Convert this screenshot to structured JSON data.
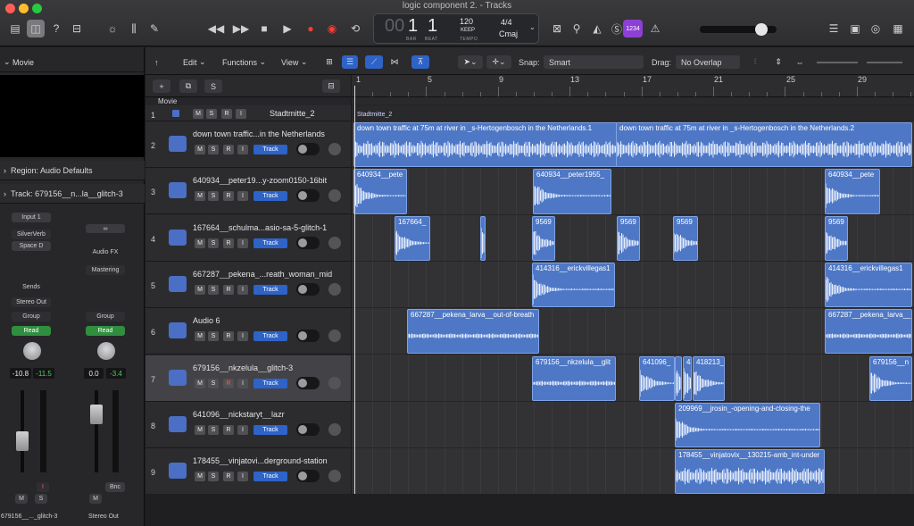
{
  "window": {
    "title": "logic component 2. - Tracks"
  },
  "lcd": {
    "bar": "1",
    "beat": "1",
    "bar_label": "BAR",
    "beat_label": "BEAT",
    "tempo": "120",
    "keep": "KEEP",
    "tempo_label": "TEMPO",
    "signature": "4/4",
    "key": "Cmaj"
  },
  "cpu_badge": "1234",
  "inspector": {
    "movie_header": "Movie",
    "region_header": "Region: Audio Defaults",
    "track_header": "Track: 679156__n...la__glitch-3",
    "strip1": {
      "input": "Input 1",
      "plugin1": "SilverVerb",
      "plugin2": "Space D",
      "sends": "Sends",
      "output": "Stereo Out",
      "group": "Group",
      "automation": "Read",
      "vol_left": "-10.8",
      "vol_right": "-11.5",
      "mute": "M",
      "solo": "S",
      "rec": "I",
      "name": "679156__..._glitch-3"
    },
    "strip2": {
      "audiofx": "Audio FX",
      "mastering": "Mastering",
      "group": "Group",
      "automation": "Read",
      "vol_left": "0.0",
      "vol_right": "-3.4",
      "bounce": "Bnc",
      "name": "Stereo Out",
      "mute": "M"
    }
  },
  "toolbar": {
    "edit": "Edit",
    "functions": "Functions",
    "view": "View",
    "snap_label": "Snap:",
    "snap_value": "Smart",
    "drag_label": "Drag:",
    "drag_value": "No Overlap"
  },
  "header_buttons": {
    "add": "+",
    "dup": "⧉",
    "s": "S"
  },
  "ruler": {
    "bars": [
      "1",
      "5",
      "9",
      "13",
      "17",
      "21",
      "25",
      "29"
    ]
  },
  "tracks": [
    {
      "num": "1",
      "name": "Stadtmitte_2",
      "mute": "M",
      "solo": "S",
      "rec": "R",
      "input": "I"
    },
    {
      "num": "2",
      "name": "down town traffic...in the Netherlands",
      "mute": "M",
      "solo": "S",
      "rec": "R",
      "input": "I",
      "btn": "Track"
    },
    {
      "num": "3",
      "name": "640934__peter19...y-zoom0150-16bit",
      "mute": "M",
      "solo": "S",
      "rec": "R",
      "input": "I",
      "btn": "Track"
    },
    {
      "num": "4",
      "name": "167664__schulma...asio-sa-5-glitch-1",
      "mute": "M",
      "solo": "S",
      "rec": "R",
      "input": "I",
      "btn": "Track"
    },
    {
      "num": "5",
      "name": "667287__pekena_...reath_woman_mid",
      "mute": "M",
      "solo": "S",
      "rec": "R",
      "input": "I",
      "btn": "Track"
    },
    {
      "num": "6",
      "name": "Audio 6",
      "mute": "M",
      "solo": "S",
      "rec": "R",
      "input": "I",
      "btn": "Track"
    },
    {
      "num": "7",
      "name": "679156__nkzelula__glitch-3",
      "mute": "M",
      "solo": "S",
      "rec": "R",
      "input": "I",
      "btn": "Track"
    },
    {
      "num": "8",
      "name": "641096__nickstaryt__lazr",
      "mute": "M",
      "solo": "S",
      "rec": "R",
      "input": "I",
      "btn": "Track"
    },
    {
      "num": "9",
      "name": "178455__vinjatovi...derground-station",
      "mute": "M",
      "solo": "S",
      "rec": "R",
      "input": "I",
      "btn": "Track"
    }
  ],
  "movie_lane": {
    "label": "Movie"
  },
  "regions": {
    "movie": "Stadtmitte_2",
    "t2a": "down town traffic at 75m at river in _s-Hertogenbosch in the Netherlands.1",
    "t2b": "down town traffic at 75m at river in _s-Hertogenbosch in the Netherlands.2",
    "t3a": "640934__pete",
    "t3b": "640934__peter1955_",
    "t3c": "640934__pete",
    "t4a": "167664_",
    "t4b": "9569",
    "t4c": "9569",
    "t4d": "9569",
    "t4e": "9569",
    "t5a": "414316__erickvillegas1",
    "t5b": "414316__erickvillegas1",
    "t6a": "667287__pekena_larva__out-of-breath",
    "t6b": "667287__pekena_larva__",
    "t7a": "679156__nkzelula__glit",
    "t7b": "641096_",
    "t7c": "4",
    "t7d": "418213_",
    "t7e": "679156__n",
    "t8a": "209969__jrosin_-opening-and-closing-the",
    "t9a": "178455__vinjatovix__130215-amb_int-under"
  },
  "colors": {
    "region": "#4e78c6",
    "track_button": "#2e63c8",
    "automation": "#2f8f3f",
    "cpu": "#8d3fd6"
  }
}
